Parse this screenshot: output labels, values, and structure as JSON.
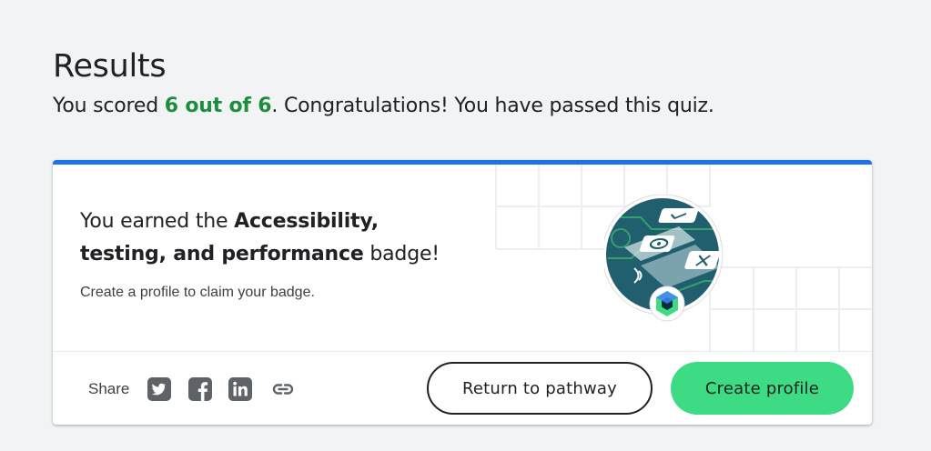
{
  "results": {
    "title": "Results",
    "score_prefix": "You scored ",
    "score_value": "6 out of 6",
    "score_suffix": ". Congratulations! You have passed this quiz."
  },
  "badge_card": {
    "heading_prefix": "You earned the ",
    "badge_name": "Accessibility, testing, and performance",
    "heading_suffix": " badge!",
    "subtitle": "Create a profile to claim your badge.",
    "accent_color": "#1a73e8"
  },
  "share": {
    "label": "Share",
    "icons": [
      "twitter-icon",
      "facebook-icon",
      "linkedin-icon",
      "link-icon"
    ]
  },
  "actions": {
    "return_label": "Return to pathway",
    "create_label": "Create profile",
    "primary_color": "#3ddc84"
  },
  "colors": {
    "score_green": "#1e8e3e",
    "background": "#f1f3f4",
    "icon_gray": "#5f6368"
  }
}
